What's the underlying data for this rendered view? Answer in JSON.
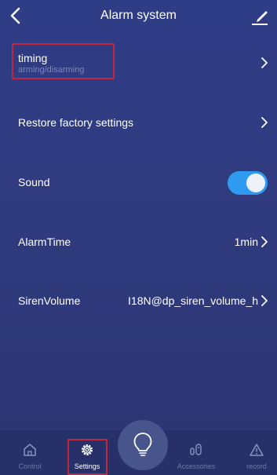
{
  "header": {
    "title": "Alarm system"
  },
  "rows": {
    "timing": {
      "title": "timing",
      "subtitle": "arming/disarming"
    },
    "restore": {
      "label": "Restore factory settings"
    },
    "sound": {
      "label": "Sound",
      "enabled": true
    },
    "alarm_time": {
      "label": "AlarmTime",
      "value": "1min"
    },
    "siren_volume": {
      "label": "SirenVolume",
      "value": "I18N@dp_siren_volume_h"
    }
  },
  "tabs": [
    {
      "label": "Control",
      "icon": "home-icon"
    },
    {
      "label": "Settings",
      "icon": "gear-icon",
      "active": true
    },
    {
      "label": "Accessories",
      "icon": "accessories-icon"
    },
    {
      "label": "record",
      "icon": "warning-icon"
    }
  ],
  "center_button": {
    "icon": "lightbulb-icon"
  },
  "colors": {
    "background": "#2f3d86",
    "toggle_on": "#2f9bf0",
    "highlight_border": "#c3253a",
    "subtitle": "#7c88b8"
  }
}
